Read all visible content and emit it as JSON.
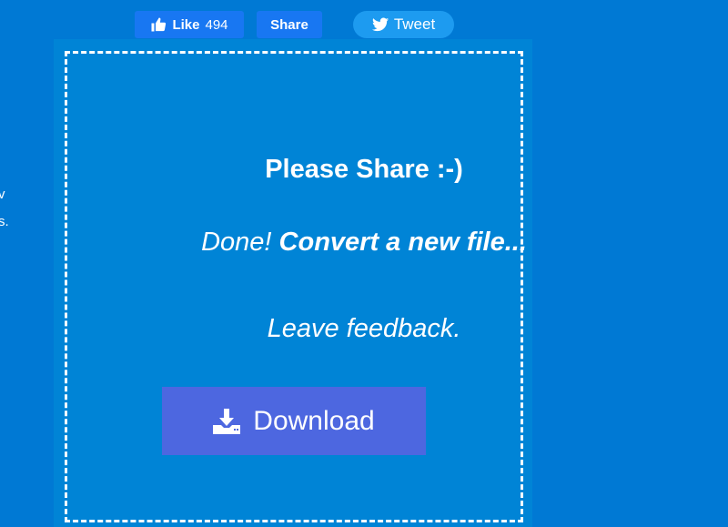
{
  "left_edge": {
    "line1": "v",
    "line2": "s."
  },
  "social": {
    "like_label": "Like",
    "like_count": "494",
    "share_label": "Share",
    "tweet_label": "Tweet"
  },
  "panel": {
    "please_share": "Please Share :-)",
    "done_text": "Done!",
    "convert_link": "Convert a new file...",
    "feedback_link": "Leave feedback.",
    "download_label": "Download"
  },
  "icons": {
    "like": "thumbs-up-icon",
    "tweet": "twitter-bird-icon",
    "download": "download-icon"
  },
  "colors": {
    "background": "#0079d4",
    "panel": "#0084d6",
    "facebook": "#1877f2",
    "twitter": "#1d9bf0",
    "download_button": "#4d67e0"
  }
}
